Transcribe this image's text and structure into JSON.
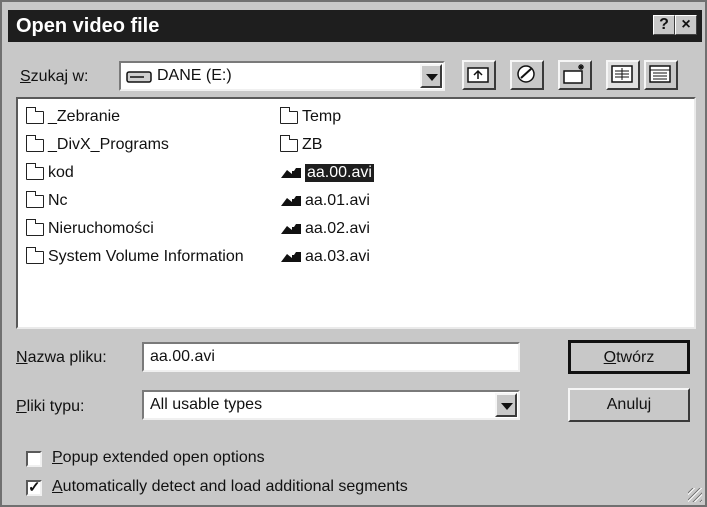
{
  "window": {
    "title": "Open video file"
  },
  "title_buttons": {
    "help": "?",
    "close": "×"
  },
  "look_in": {
    "label_u": "S",
    "label_rest": "zukaj w:",
    "value": "DANE (E:)"
  },
  "toolbar": {
    "icons": [
      "up-folder-icon",
      "desktop-icon",
      "new-folder-icon",
      "list-view-icon",
      "details-view-icon"
    ]
  },
  "files": [
    {
      "name": "_Zebranie",
      "type": "folder"
    },
    {
      "name": "_DivX_Programs",
      "type": "folder"
    },
    {
      "name": "kod",
      "type": "folder"
    },
    {
      "name": "Nc",
      "type": "folder"
    },
    {
      "name": "Nieruchomości",
      "type": "folder"
    },
    {
      "name": "System Volume Information",
      "type": "folder"
    },
    {
      "name": "Temp",
      "type": "folder"
    },
    {
      "name": "ZB",
      "type": "folder"
    },
    {
      "name": "aa.00.avi",
      "type": "video",
      "selected": true
    },
    {
      "name": "aa.01.avi",
      "type": "video"
    },
    {
      "name": "aa.02.avi",
      "type": "video"
    },
    {
      "name": "aa.03.avi",
      "type": "video"
    }
  ],
  "filename": {
    "label_u": "N",
    "label_rest": "azwa pliku:",
    "value": "aa.00.avi"
  },
  "filetype": {
    "label_u": "P",
    "label_rest": "liki typu:",
    "value": "All usable types"
  },
  "buttons": {
    "open_u": "O",
    "open_rest": "twórz",
    "cancel": "Anuluj"
  },
  "options": {
    "popup": {
      "u": "P",
      "rest": "opup extended open options",
      "checked": false
    },
    "auto": {
      "u": "A",
      "rest": "utomatically detect and load additional segments",
      "checked": true,
      "mark": "✓"
    }
  }
}
